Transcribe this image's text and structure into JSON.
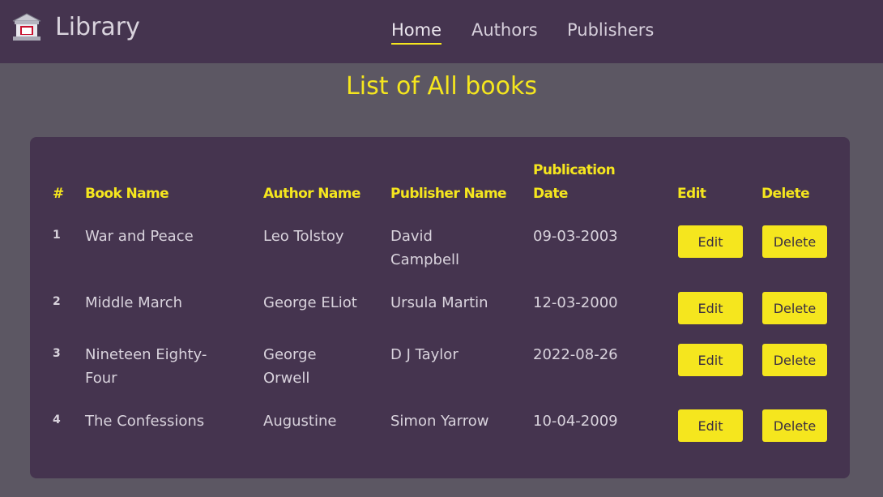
{
  "navbar": {
    "brand": "Library",
    "links": [
      {
        "label": "Home",
        "active": true
      },
      {
        "label": "Authors",
        "active": false
      },
      {
        "label": "Publishers",
        "active": false
      }
    ]
  },
  "page_title": "List of All books",
  "table": {
    "headers": {
      "num": "#",
      "book_name": "Book Name",
      "author_name": "Author Name",
      "publisher_name": "Publisher Name",
      "publication_date_line1": "Publication",
      "publication_date_line2": "Date",
      "edit": "Edit",
      "delete": "Delete"
    },
    "rows": [
      {
        "num": "1",
        "book_name": "War and Peace",
        "author_name": "Leo Tolstoy",
        "publisher_name": "David Campbell",
        "publication_date": "09-03-2003",
        "edit_label": "Edit",
        "delete_label": "Delete"
      },
      {
        "num": "2",
        "book_name": "Middle March",
        "author_name": "George ELiot",
        "publisher_name": "Ursula Martin",
        "publication_date": "12-03-2000",
        "edit_label": "Edit",
        "delete_label": "Delete"
      },
      {
        "num": "3",
        "book_name": "Nineteen Eighty-Four",
        "author_name": "George Orwell",
        "publisher_name": "D J Taylor",
        "publication_date": "2022-08-26",
        "edit_label": "Edit",
        "delete_label": "Delete"
      },
      {
        "num": "4",
        "book_name": "The Confessions",
        "author_name": "Augustine",
        "publisher_name": "Simon Yarrow",
        "publication_date": "10-04-2009",
        "edit_label": "Edit",
        "delete_label": "Delete"
      }
    ]
  },
  "colors": {
    "navbar_bg": "#45344f",
    "page_bg": "#5c5763",
    "card_bg": "#45344f",
    "accent": "#f5e61e",
    "text": "#d9d3dd"
  },
  "icons": {
    "brand": "library-building-icon"
  }
}
